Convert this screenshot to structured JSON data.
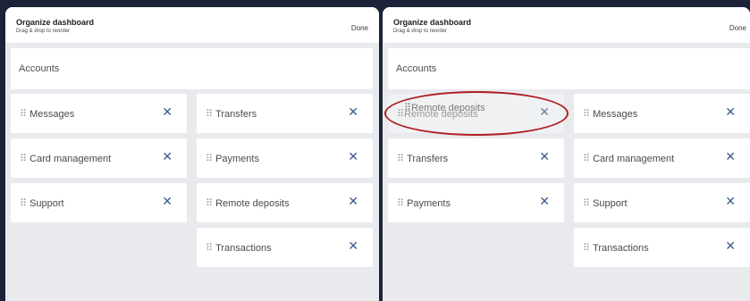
{
  "left_panel": {
    "title": "Organize dashboard",
    "subtitle": "Drag & drop to reorder",
    "done_label": "Done",
    "accounts_label": "Accounts",
    "tiles": [
      {
        "label": "Messages"
      },
      {
        "label": "Transfers"
      },
      {
        "label": "Card management"
      },
      {
        "label": "Payments"
      },
      {
        "label": "Support"
      },
      {
        "label": "Remote deposits"
      },
      {
        "label": "Transactions"
      }
    ]
  },
  "right_panel": {
    "title": "Organize dashboard",
    "subtitle": "Drag & drop to reorder",
    "done_label": "Done",
    "accounts_label": "Accounts",
    "dragging_tile": {
      "label": "Remote deposits"
    },
    "tiles": [
      {
        "label": "Messages"
      },
      {
        "label": "Transfers"
      },
      {
        "label": "Card management"
      },
      {
        "label": "Payments"
      },
      {
        "label": "Support"
      },
      {
        "label": "Transactions"
      }
    ]
  },
  "icons": {
    "grip": "⠿",
    "close": "✕"
  },
  "colors": {
    "background": "#1c2237",
    "panel": "#e9eaee",
    "close_icon": "#3b5a8a",
    "highlight": "#b01e24"
  }
}
